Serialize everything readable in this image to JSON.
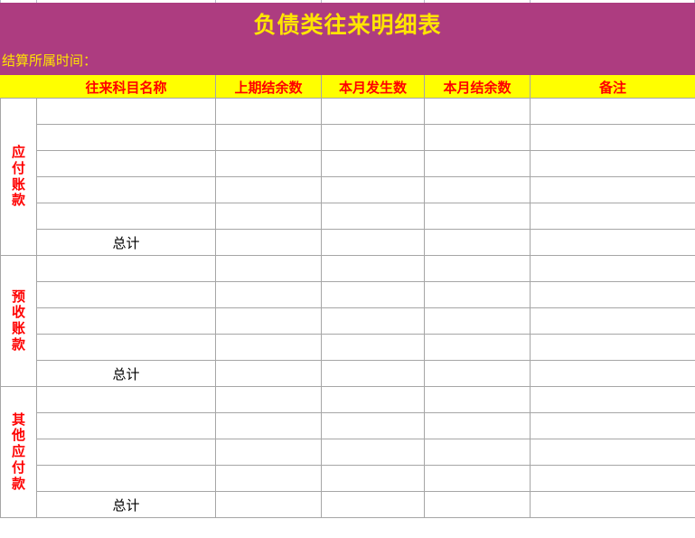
{
  "document": {
    "title": "负债类往来明细表",
    "period_label": "结算所属时间：",
    "period_value": ""
  },
  "theme": {
    "banner_bg": "#ad3c80",
    "banner_text": "#ffe500",
    "header_bg": "#ffff00",
    "header_text": "#ff0000",
    "label_bg": "#ffff00",
    "label_text": "#ff0000",
    "grid_line": "#a6a6a6",
    "cell_bg": "#ffffff",
    "total_text": "#000000"
  },
  "table": {
    "columns": [
      {
        "key": "group",
        "label": ""
      },
      {
        "key": "name",
        "label": "往来科目名称"
      },
      {
        "key": "prev",
        "label": "上期结余数"
      },
      {
        "key": "cur",
        "label": "本月发生数"
      },
      {
        "key": "bal",
        "label": "本月结余数"
      },
      {
        "key": "note",
        "label": "备注"
      }
    ],
    "total_label": "总计",
    "groups": [
      {
        "label": "应付账款",
        "label_chars": [
          "应",
          "付",
          "账",
          "款"
        ],
        "rows": [
          {
            "name": "",
            "prev": "",
            "cur": "",
            "bal": "",
            "note": ""
          },
          {
            "name": "",
            "prev": "",
            "cur": "",
            "bal": "",
            "note": ""
          },
          {
            "name": "",
            "prev": "",
            "cur": "",
            "bal": "",
            "note": ""
          },
          {
            "name": "",
            "prev": "",
            "cur": "",
            "bal": "",
            "note": ""
          },
          {
            "name": "",
            "prev": "",
            "cur": "",
            "bal": "",
            "note": ""
          }
        ],
        "total": {
          "name": "总计",
          "prev": "",
          "cur": "",
          "bal": "",
          "note": ""
        }
      },
      {
        "label": "预收账款",
        "label_chars": [
          "预",
          "收",
          "账",
          "款"
        ],
        "rows": [
          {
            "name": "",
            "prev": "",
            "cur": "",
            "bal": "",
            "note": ""
          },
          {
            "name": "",
            "prev": "",
            "cur": "",
            "bal": "",
            "note": ""
          },
          {
            "name": "",
            "prev": "",
            "cur": "",
            "bal": "",
            "note": ""
          },
          {
            "name": "",
            "prev": "",
            "cur": "",
            "bal": "",
            "note": ""
          }
        ],
        "total": {
          "name": "总计",
          "prev": "",
          "cur": "",
          "bal": "",
          "note": ""
        }
      },
      {
        "label": "其他应付款",
        "label_chars": [
          "其",
          "他",
          "应",
          "付",
          "款"
        ],
        "rows": [
          {
            "name": "",
            "prev": "",
            "cur": "",
            "bal": "",
            "note": ""
          },
          {
            "name": "",
            "prev": "",
            "cur": "",
            "bal": "",
            "note": ""
          },
          {
            "name": "",
            "prev": "",
            "cur": "",
            "bal": "",
            "note": ""
          },
          {
            "name": "",
            "prev": "",
            "cur": "",
            "bal": "",
            "note": ""
          }
        ],
        "total": {
          "name": "总计",
          "prev": "",
          "cur": "",
          "bal": "",
          "note": ""
        }
      }
    ]
  }
}
